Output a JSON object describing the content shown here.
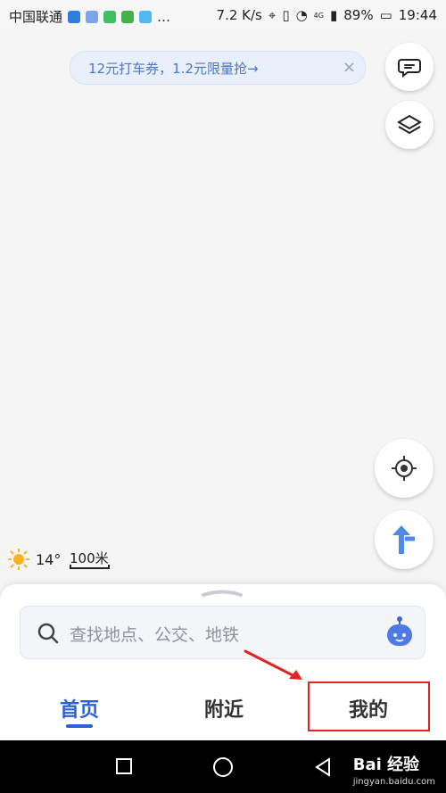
{
  "status": {
    "carrier": "中国联通",
    "speed": "7.2 K/s",
    "signal_label": "4G",
    "battery": "89%",
    "time": "19:44"
  },
  "promo": {
    "text": "12元打车券，1.2元限量抢→",
    "close": "×"
  },
  "weather": {
    "temperature": "14°"
  },
  "map": {
    "scale": "100米"
  },
  "search": {
    "placeholder": "查找地点、公交、地铁"
  },
  "tabs": {
    "home": "首页",
    "nearby": "附近",
    "mine": "我的"
  },
  "watermark": {
    "main": "Bai 经验",
    "sub": "jingyan.baidu.com"
  },
  "colors": {
    "accent": "#2b62d9",
    "annotation": "#e02424"
  }
}
